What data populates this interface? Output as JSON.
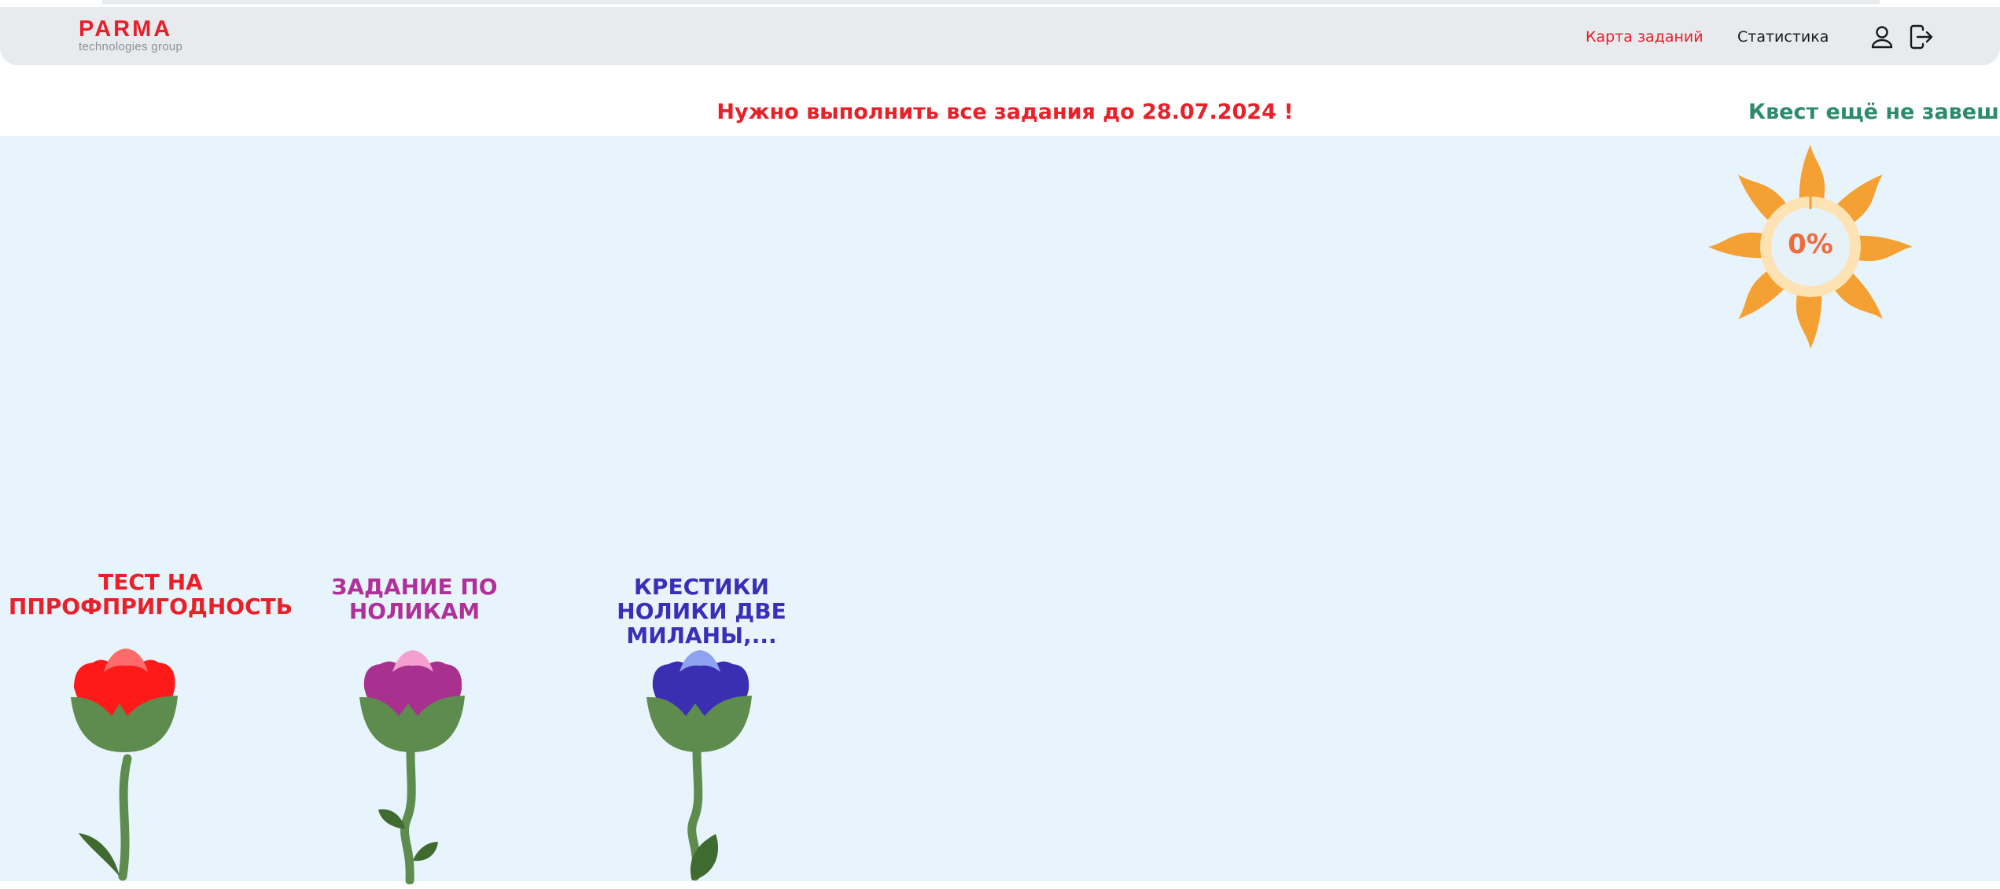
{
  "header": {
    "logo_name": "PARMA",
    "logo_tagline": "technologies group",
    "nav": {
      "map": "Карта заданий",
      "stats": "Статистика"
    },
    "icons": [
      "user-icon",
      "logout-icon"
    ]
  },
  "banner": {
    "deadline": "Нужно выполнить все задания до 28.07.2024 !",
    "quest_status": "Квест ещё не завешен"
  },
  "progress": {
    "label": "0%",
    "percent": 0
  },
  "tasks": [
    {
      "title": "Тест на ппрофпригодность",
      "color": "#ff1a1a"
    },
    {
      "title": "Задание по ноликам",
      "color": "#a8318f"
    },
    {
      "title": "Крестики нолики две Миланы,...",
      "color": "#3a2fb3"
    }
  ],
  "colors": {
    "accent": "#e8202a",
    "status_green": "#2e8b6a",
    "field_bg": "#e8f4fb",
    "sun": "#f5a033",
    "leaf": "#5e8c4e"
  }
}
